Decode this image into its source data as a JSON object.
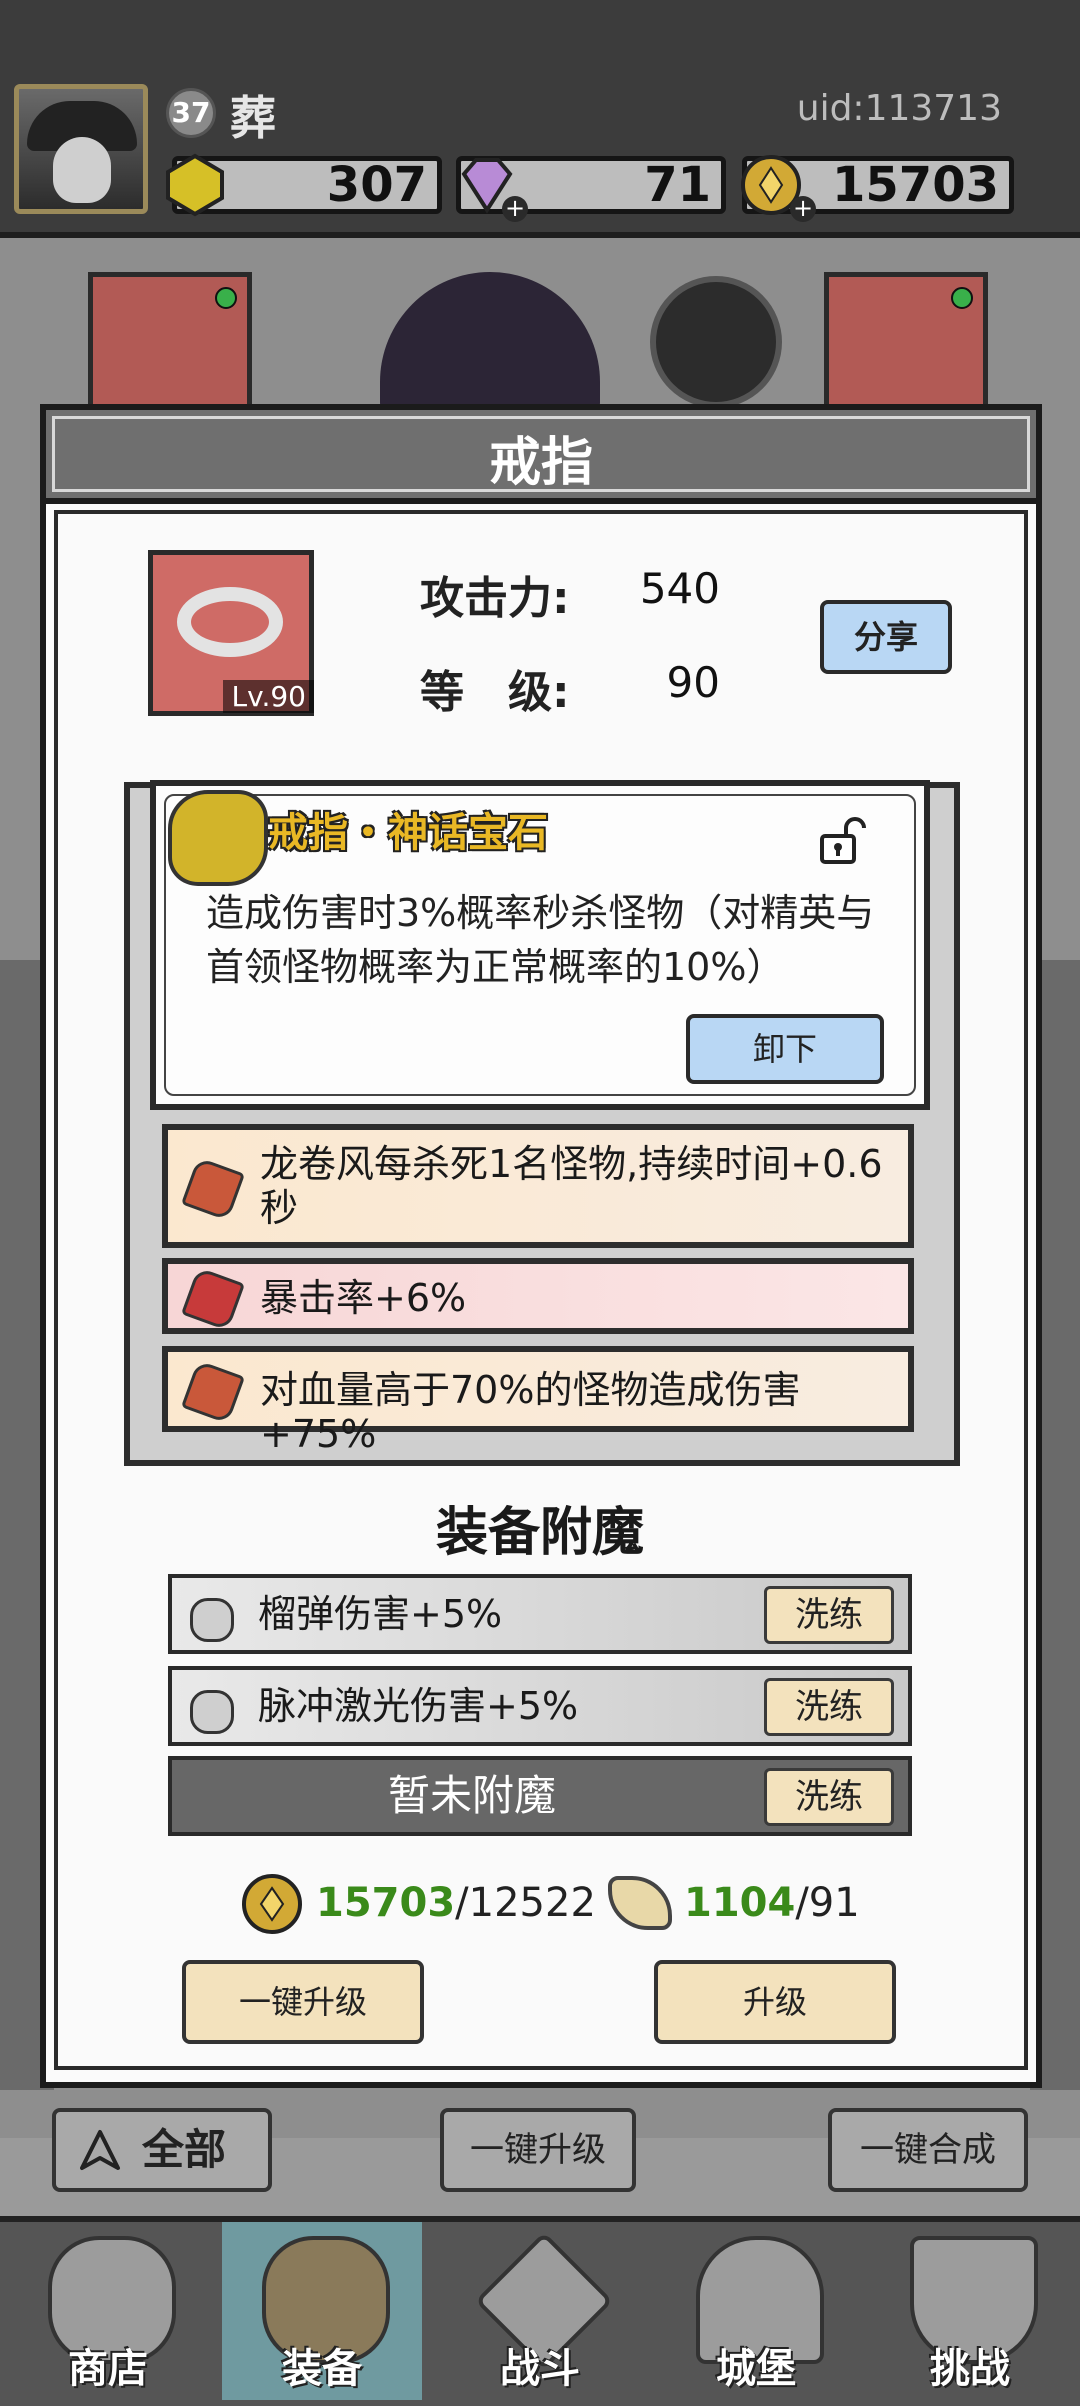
{
  "player": {
    "level": "37",
    "name": "葬",
    "uid": "uid:113713"
  },
  "resources": {
    "gold_gem": "307",
    "crystal": "71",
    "coins": "15703"
  },
  "modal": {
    "title": "戒指"
  },
  "item": {
    "level_tag": "Lv.90",
    "attack_label": "攻击力:",
    "attack_value": "540",
    "level_label": "等　级:",
    "level_value": "90",
    "share_label": "分享"
  },
  "gem": {
    "title": "戒指・神话宝石",
    "description": "造成伤害时3%概率秒杀怪物（对精英与首领怪物概率为正常概率的10%）",
    "unequip_label": "卸下"
  },
  "affixes": [
    {
      "text": "龙卷风每杀死1名怪物,持续时间+0.6秒"
    },
    {
      "text": "暴击率+6%"
    },
    {
      "text": "对血量高于70%的怪物造成伤害+75%"
    }
  ],
  "enchant": {
    "title": "装备附魔",
    "rows": [
      {
        "text": "榴弹伤害+5%",
        "button": "洗练"
      },
      {
        "text": "脉冲激光伤害+5%",
        "button": "洗练"
      },
      {
        "text": "暂未附魔",
        "button": "洗练"
      }
    ]
  },
  "cost": {
    "coins_have": "15703",
    "coins_need": "/12522",
    "scrolls_have": "1104",
    "scrolls_need": "/91"
  },
  "actions": {
    "onekey_upgrade": "一键升级",
    "upgrade": "升级"
  },
  "bottom_bar": {
    "filter_all": "全部",
    "bulk_upgrade": "一键升级",
    "bulk_merge": "一键合成"
  },
  "nav": [
    {
      "label": "商店"
    },
    {
      "label": "装备"
    },
    {
      "label": "战斗"
    },
    {
      "label": "城堡"
    },
    {
      "label": "挑战"
    }
  ],
  "colors": {
    "accent_gold": "#e9b825",
    "button_blue": "#b9d7f4",
    "button_tan": "#f3e2bd",
    "active_nav": "#6f9aa0"
  }
}
